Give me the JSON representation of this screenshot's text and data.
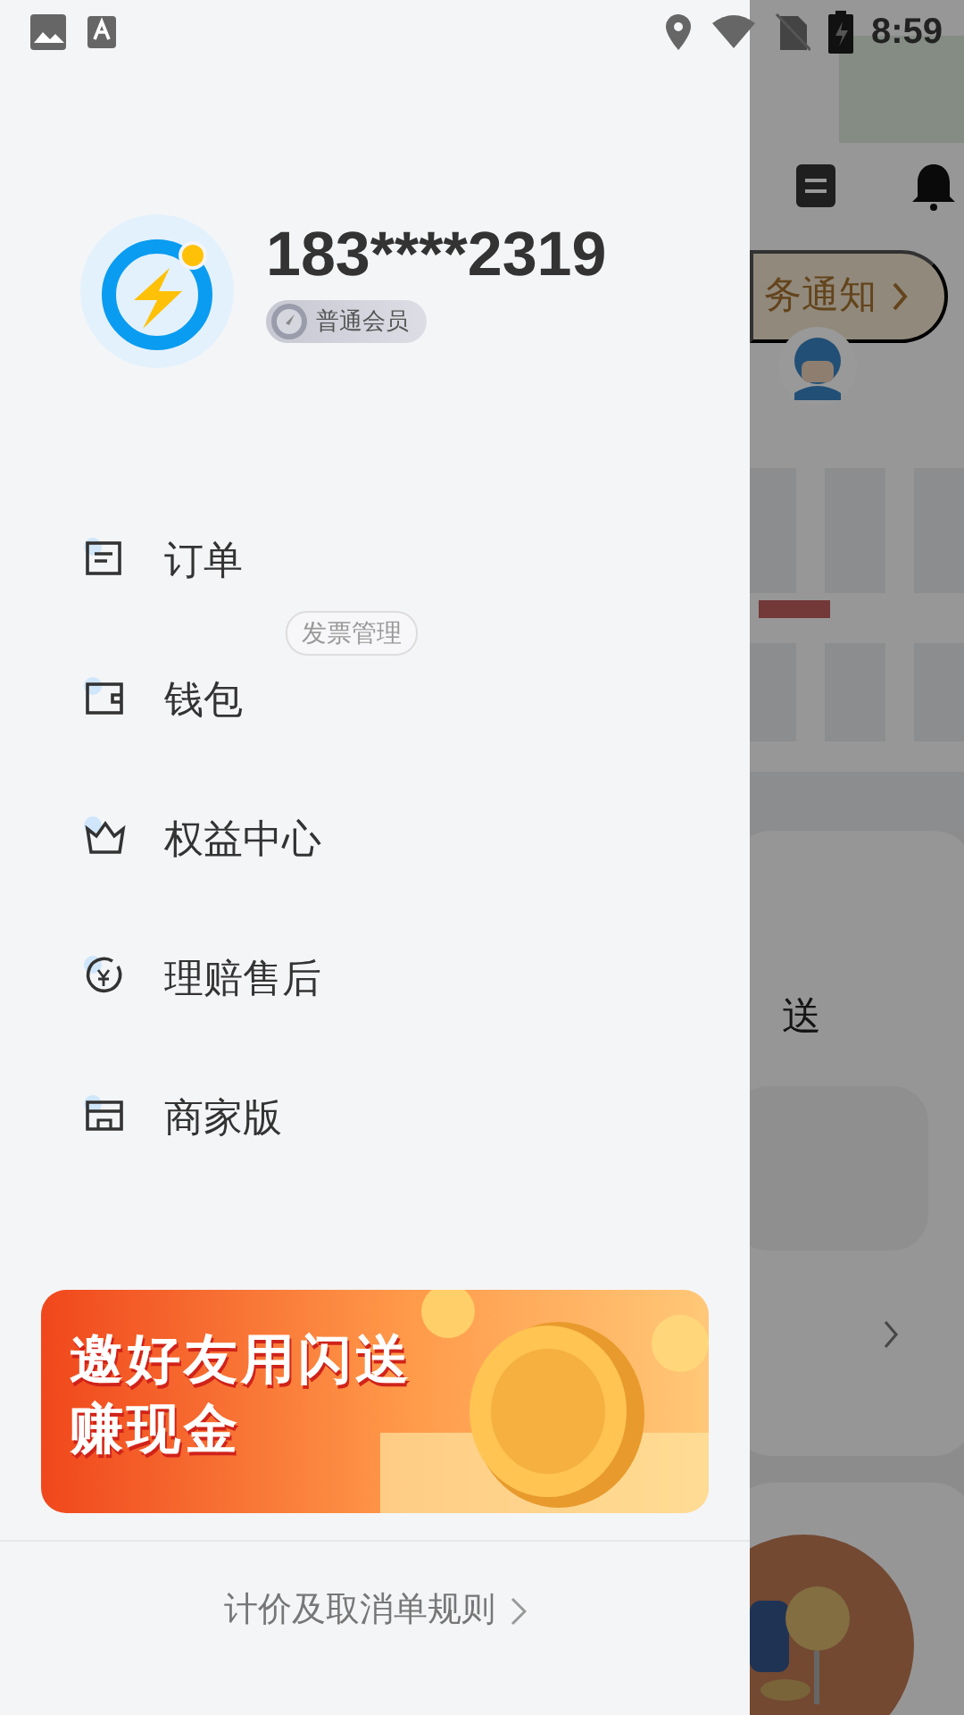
{
  "status_bar": {
    "time": "8:59"
  },
  "profile": {
    "phone": "183****2319",
    "member_level": "普通会员"
  },
  "menu": [
    {
      "label": "订单"
    },
    {
      "label": "钱包",
      "tag": "发票管理"
    },
    {
      "label": "权益中心"
    },
    {
      "label": "理赔售后"
    },
    {
      "label": "商家版"
    }
  ],
  "banner": {
    "lines": [
      "邀好友用闪送",
      "赚现金"
    ]
  },
  "footer_link": {
    "label": "计价及取消单规则"
  },
  "background": {
    "notice": "务通知",
    "card_title": "送"
  }
}
